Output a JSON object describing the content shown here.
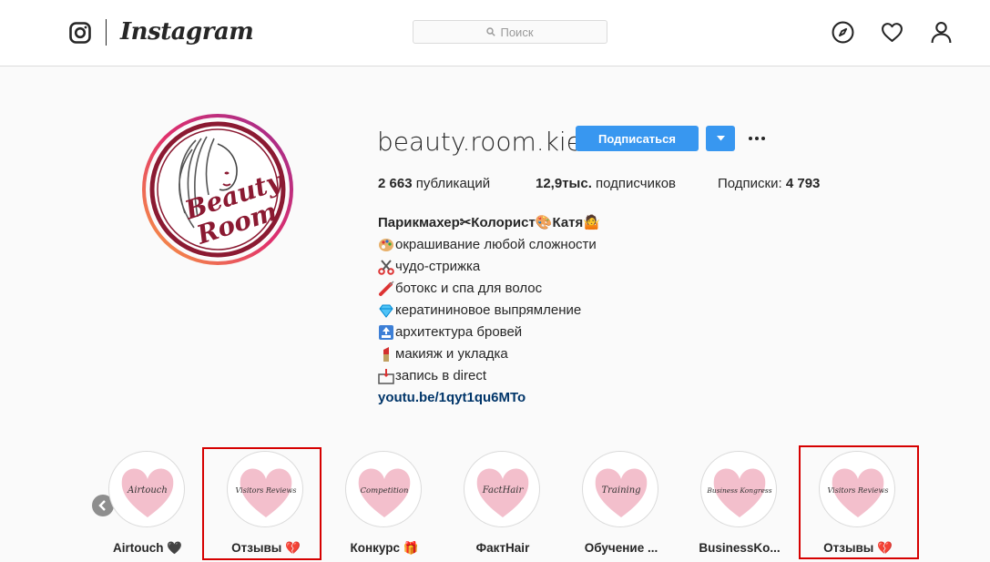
{
  "header": {
    "wordmark": "Instagram",
    "search_placeholder": "Поиск"
  },
  "profile": {
    "username": "beauty.room.kiev",
    "follow_label": "Подписаться",
    "avatar_text_line1": "Beauty",
    "avatar_text_line2": "Room",
    "stats": {
      "posts_value": "2 663",
      "posts_label": "публикаций",
      "followers_value": "12,9тыс.",
      "followers_label": "подписчиков",
      "following_label": "Подписки:",
      "following_value": "4 793"
    },
    "bio": {
      "name_line": "Парикмахер✂Колорист🎨Катя🤷",
      "lines": [
        "окрашивание любой сложности",
        "чудо-стрижка",
        "ботокс и спа для волос",
        "кератининовое выпрямление",
        "архитектура бровей",
        "макияж и укладка",
        "запись в direct"
      ],
      "link": "youtu.be/1qyt1qu6MTo"
    }
  },
  "highlights": [
    {
      "title": "Airtouch 🖤",
      "cover_text": "Airtouch"
    },
    {
      "title": "Отзывы 💔",
      "cover_text": "Visitors Reviews"
    },
    {
      "title": "Конкурс 🎁",
      "cover_text": "Competition"
    },
    {
      "title": "ФактHair",
      "cover_text": "FactHair"
    },
    {
      "title": "Обучение ...",
      "cover_text": "Training"
    },
    {
      "title": "BusinessKo...",
      "cover_text": "Business Kongress"
    },
    {
      "title": "Отзывы 💔",
      "cover_text": "Visitors Reviews"
    }
  ],
  "colors": {
    "accent": "#3897f0",
    "link": "#003569",
    "annotation": "#d60000",
    "heart": "#f2b8c6",
    "avatar_maroon": "#8b1a32"
  }
}
